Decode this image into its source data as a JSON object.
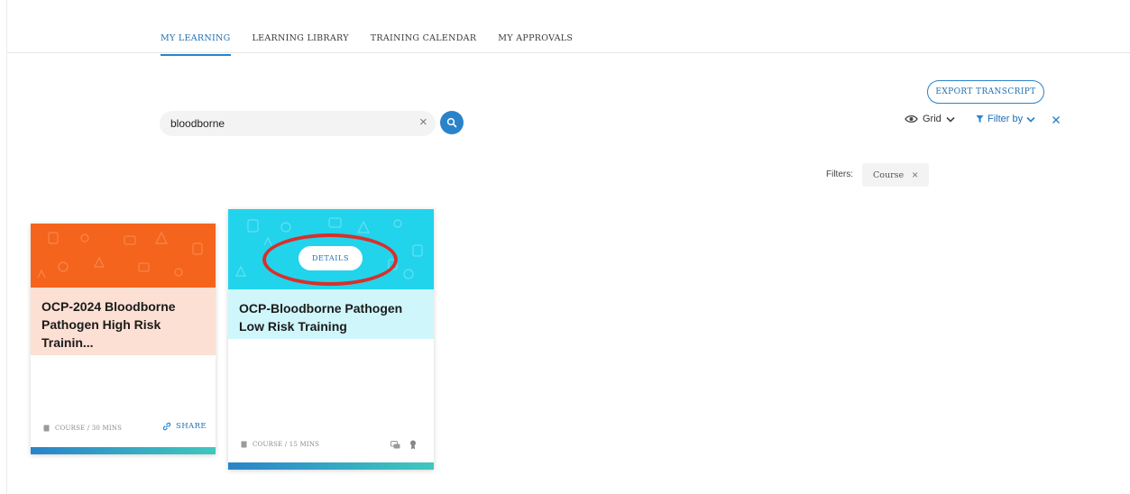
{
  "nav": {
    "tabs": [
      {
        "label": "MY LEARNING",
        "active": true
      },
      {
        "label": "LEARNING LIBRARY",
        "active": false
      },
      {
        "label": "TRAINING CALENDAR",
        "active": false
      },
      {
        "label": "MY APPROVALS",
        "active": false
      }
    ]
  },
  "toolbar": {
    "export_label": "EXPORT TRANSCRIPT",
    "view_label": "Grid",
    "filter_label": "Filter by"
  },
  "search": {
    "value": "bloodborne",
    "clear_symbol": "×"
  },
  "filters": {
    "label": "Filters:",
    "chips": [
      {
        "label": "Course",
        "remove_symbol": "×"
      }
    ]
  },
  "cards": [
    {
      "title": "OCP-2024 Bloodborne Pathogen High Risk Trainin...",
      "meta": "COURSE / 30 MINS",
      "share_label": "SHARE",
      "banner_color": "#f5641c"
    },
    {
      "title": "OCP-Bloodborne Pathogen Low Risk Training",
      "meta": "COURSE / 15 MINS",
      "details_label": "DETAILS",
      "banner_color": "#22d3ec"
    }
  ],
  "colors": {
    "accent": "#2a83c9",
    "highlight": "#d8302a"
  },
  "icons": [
    "search-icon",
    "eye-icon",
    "chevron-down-icon",
    "filter-icon",
    "close-icon",
    "book-icon",
    "link-icon",
    "chat-icon",
    "badge-icon"
  ]
}
